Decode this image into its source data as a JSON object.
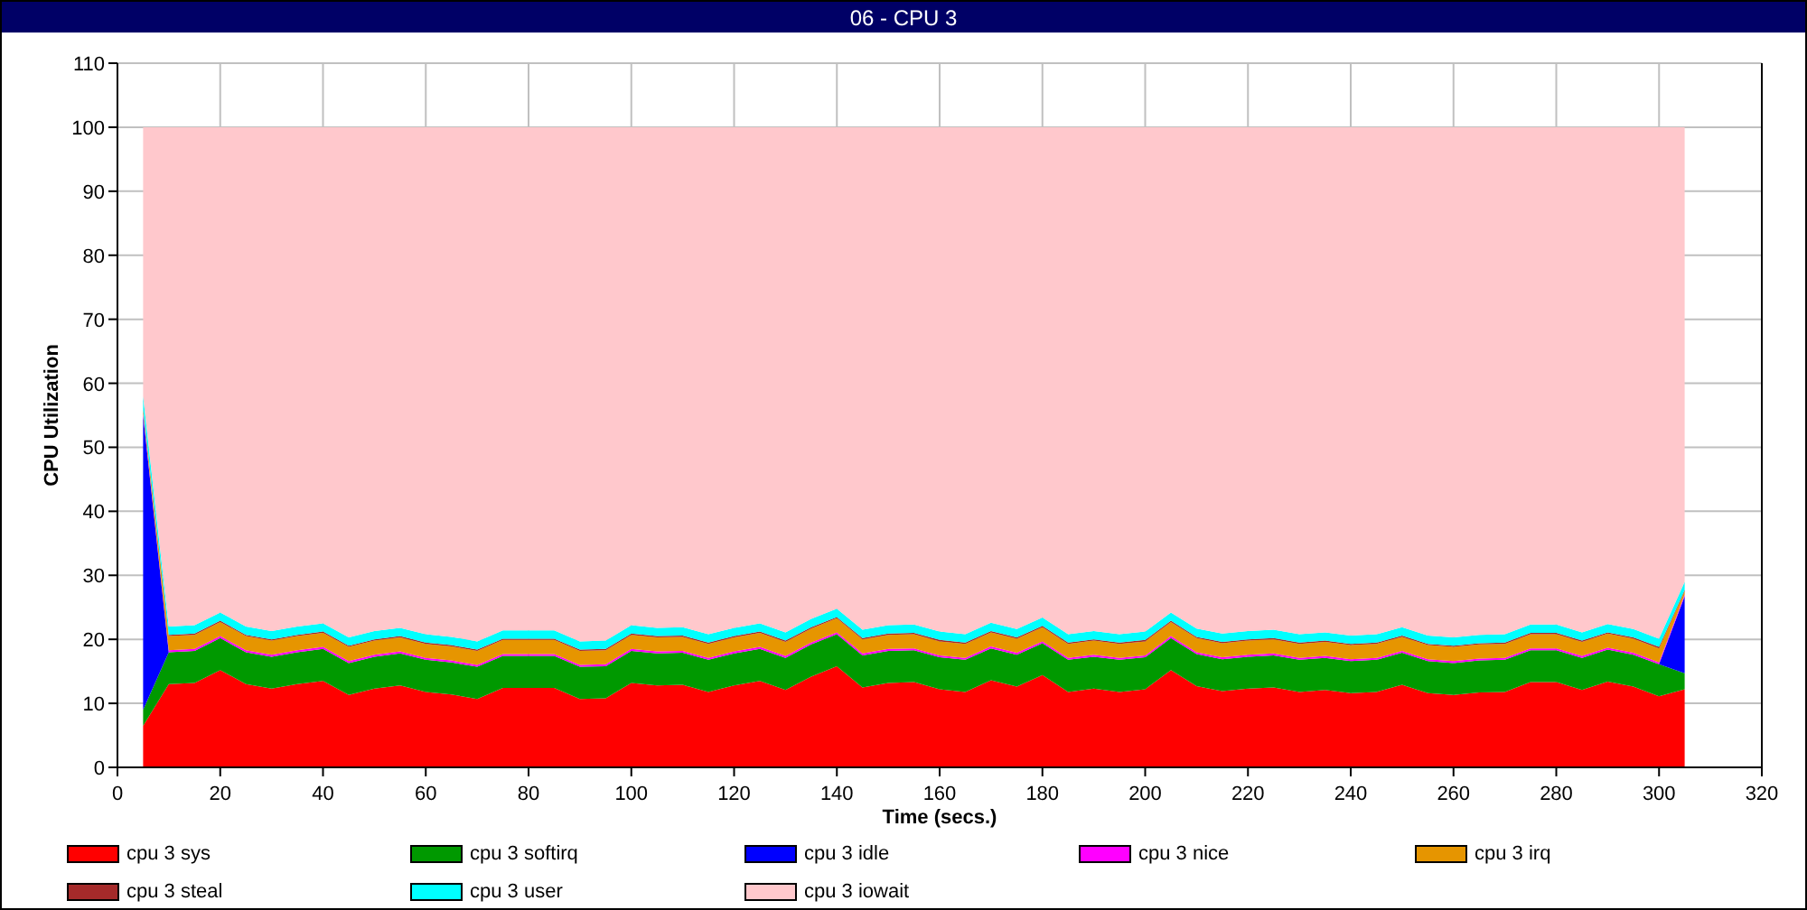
{
  "window": {
    "title": "06 - CPU 3"
  },
  "chart": {
    "chart_data": {
      "type": "area",
      "stacked": true,
      "grid": true,
      "xlabel": "Time (secs.)",
      "ylabel": "CPU Utilization",
      "xlim": [
        0,
        320
      ],
      "ylim": [
        0,
        110
      ],
      "xticks": [
        0,
        20,
        40,
        60,
        80,
        100,
        120,
        140,
        160,
        180,
        200,
        220,
        240,
        260,
        280,
        300,
        320
      ],
      "yticks": [
        0,
        10,
        20,
        30,
        40,
        50,
        60,
        70,
        80,
        90,
        100,
        110
      ],
      "x": [
        5,
        10,
        15,
        20,
        25,
        30,
        35,
        40,
        45,
        50,
        55,
        60,
        65,
        70,
        75,
        80,
        85,
        90,
        95,
        100,
        105,
        110,
        115,
        120,
        125,
        130,
        135,
        140,
        145,
        150,
        155,
        160,
        165,
        170,
        175,
        180,
        185,
        190,
        195,
        200,
        205,
        210,
        215,
        220,
        225,
        230,
        235,
        240,
        245,
        250,
        255,
        260,
        265,
        270,
        275,
        280,
        285,
        290,
        295,
        300,
        305
      ],
      "series": [
        {
          "name": "cpu 3 sys",
          "color": "#ff0000",
          "values": [
            6.5,
            13,
            13.2,
            15.2,
            13,
            12.3,
            13,
            13.5,
            11.3,
            12.3,
            12.8,
            11.8,
            11.4,
            10.7,
            12.4,
            12.4,
            12.4,
            10.7,
            10.8,
            13.2,
            12.8,
            12.9,
            11.8,
            12.8,
            13.5,
            12.1,
            14.2,
            15.8,
            12.5,
            13.2,
            13.3,
            12.2,
            11.8,
            13.6,
            12.6,
            14.4,
            11.8,
            12.3,
            11.8,
            12.2,
            15.2,
            12.7,
            11.9,
            12.3,
            12.5,
            11.8,
            12.1,
            11.6,
            11.8,
            12.9,
            11.6,
            11.3,
            11.7,
            11.8,
            13.3,
            13.3,
            12.1,
            13.4,
            12.6,
            11.1,
            12.2
          ]
        },
        {
          "name": "cpu 3 softirq",
          "color": "#009900",
          "values": [
            2.5,
            5,
            5,
            5,
            5,
            5,
            5,
            5,
            5,
            5,
            5,
            5,
            5,
            5,
            5,
            5,
            5,
            5,
            5,
            5,
            5,
            5,
            5,
            5,
            5,
            5,
            5,
            5,
            5,
            5,
            5,
            5,
            5,
            5,
            5,
            5,
            5,
            5,
            5,
            5,
            5,
            5,
            5,
            5,
            5,
            5,
            5,
            5,
            5,
            5,
            5,
            5,
            5,
            5,
            5,
            5,
            5,
            5,
            5,
            5,
            2.5
          ]
        },
        {
          "name": "cpu 3 idle",
          "color": "#0000ff",
          "values": [
            46,
            0,
            0,
            0,
            0,
            0,
            0,
            0,
            0,
            0,
            0,
            0,
            0,
            0,
            0,
            0,
            0,
            0,
            0,
            0,
            0,
            0,
            0,
            0,
            0,
            0,
            0,
            0,
            0,
            0,
            0,
            0,
            0,
            0,
            0,
            0,
            0,
            0,
            0,
            0,
            0,
            0,
            0,
            0,
            0,
            0,
            0,
            0,
            0,
            0,
            0,
            0,
            0,
            0,
            0,
            0,
            0,
            0,
            0,
            0,
            12
          ]
        },
        {
          "name": "cpu 3 nice",
          "color": "#ff00ff",
          "values": [
            0.3,
            0.3,
            0.3,
            0.3,
            0.3,
            0.3,
            0.3,
            0.3,
            0.3,
            0.3,
            0.3,
            0.3,
            0.3,
            0.3,
            0.3,
            0.3,
            0.3,
            0.3,
            0.3,
            0.3,
            0.3,
            0.3,
            0.3,
            0.3,
            0.3,
            0.3,
            0.3,
            0.3,
            0.3,
            0.3,
            0.3,
            0.3,
            0.3,
            0.3,
            0.3,
            0.3,
            0.3,
            0.3,
            0.3,
            0.3,
            0.3,
            0.3,
            0.3,
            0.3,
            0.3,
            0.3,
            0.3,
            0.3,
            0.3,
            0.3,
            0.3,
            0.3,
            0.3,
            0.3,
            0.3,
            0.3,
            0.3,
            0.3,
            0.3,
            0.3,
            0.3
          ]
        },
        {
          "name": "cpu 3 irq",
          "color": "#e69500",
          "values": [
            0.5,
            2.2,
            2.2,
            2.2,
            2.2,
            2.2,
            2.2,
            2.2,
            2.2,
            2.2,
            2.2,
            2.2,
            2.2,
            2.2,
            2.2,
            2.2,
            2.2,
            2.2,
            2.2,
            2.2,
            2.2,
            2.2,
            2.2,
            2.2,
            2.2,
            2.2,
            2.2,
            2.2,
            2.2,
            2.2,
            2.2,
            2.2,
            2.2,
            2.2,
            2.2,
            2.2,
            2.2,
            2.2,
            2.2,
            2.2,
            2.2,
            2.2,
            2.2,
            2.2,
            2.2,
            2.2,
            2.2,
            2.2,
            2.2,
            2.2,
            2.2,
            2.2,
            2.2,
            2.2,
            2.2,
            2.2,
            2.2,
            2.2,
            2.2,
            2.2,
            0.5
          ]
        },
        {
          "name": "cpu 3 steal",
          "color": "#a52a2a",
          "values": [
            0.2,
            0.2,
            0.2,
            0.2,
            0.2,
            0.2,
            0.2,
            0.2,
            0.2,
            0.2,
            0.2,
            0.2,
            0.2,
            0.2,
            0.2,
            0.2,
            0.2,
            0.2,
            0.2,
            0.2,
            0.2,
            0.2,
            0.2,
            0.2,
            0.2,
            0.2,
            0.2,
            0.2,
            0.2,
            0.2,
            0.2,
            0.2,
            0.2,
            0.2,
            0.2,
            0.2,
            0.2,
            0.2,
            0.2,
            0.2,
            0.2,
            0.2,
            0.2,
            0.2,
            0.2,
            0.2,
            0.2,
            0.2,
            0.2,
            0.2,
            0.2,
            0.2,
            0.2,
            0.2,
            0.2,
            0.2,
            0.2,
            0.2,
            0.2,
            0.2,
            0.2
          ]
        },
        {
          "name": "cpu 3 user",
          "color": "#00ffff",
          "values": [
            2,
            1.3,
            1.3,
            1.3,
            1.3,
            1.3,
            1.3,
            1.3,
            1.3,
            1.3,
            1.3,
            1.3,
            1.3,
            1.3,
            1.3,
            1.3,
            1.3,
            1.3,
            1.3,
            1.3,
            1.3,
            1.3,
            1.3,
            1.3,
            1.3,
            1.3,
            1.3,
            1.3,
            1.3,
            1.3,
            1.3,
            1.3,
            1.3,
            1.3,
            1.3,
            1.3,
            1.3,
            1.3,
            1.3,
            1.3,
            1.3,
            1.3,
            1.3,
            1.3,
            1.3,
            1.3,
            1.3,
            1.3,
            1.3,
            1.3,
            1.3,
            1.3,
            1.3,
            1.3,
            1.3,
            1.3,
            1.3,
            1.3,
            1.3,
            1.3,
            1.3
          ]
        },
        {
          "name": "cpu 3 iowait",
          "color": "#ffc8cc",
          "values": [
            42,
            78,
            77.8,
            75.8,
            78,
            78.7,
            78,
            77.5,
            79.7,
            78.7,
            78.2,
            79.2,
            79.6,
            80.3,
            78.6,
            78.6,
            78.6,
            80.3,
            80.2,
            77.8,
            78.2,
            78.1,
            79.2,
            78.2,
            77.5,
            78.9,
            76.8,
            75.2,
            78.5,
            77.8,
            77.7,
            78.8,
            79.2,
            77.4,
            78.4,
            76.6,
            79.2,
            78.7,
            79.2,
            78.8,
            75.8,
            78.3,
            79.1,
            78.7,
            78.5,
            79.2,
            78.9,
            79.4,
            79.2,
            78.1,
            79.4,
            79.7,
            79.3,
            79.2,
            77.7,
            77.7,
            78.9,
            77.6,
            78.4,
            79.9,
            71
          ]
        }
      ]
    }
  }
}
